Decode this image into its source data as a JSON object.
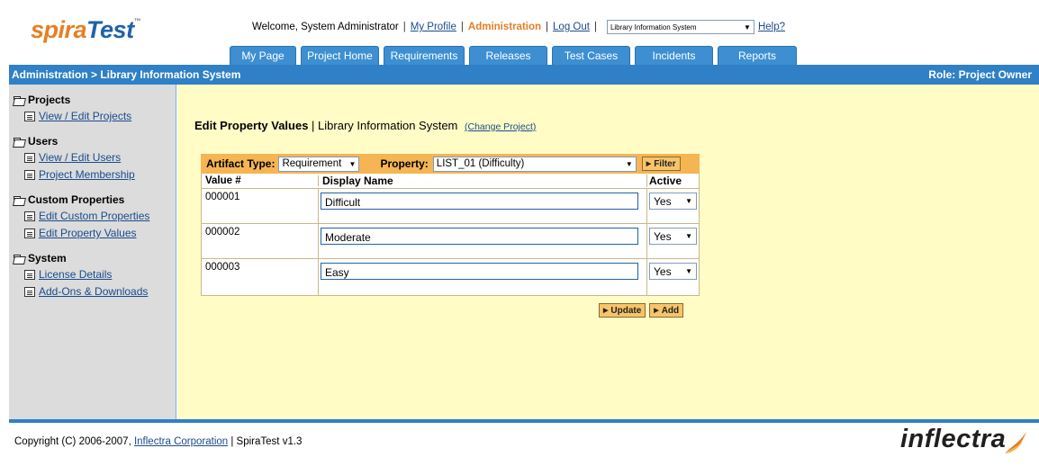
{
  "brand": {
    "part1": "spira",
    "part2": "Test",
    "tm": "™"
  },
  "topnav": {
    "welcome": "Welcome, System Administrator",
    "my_profile": "My Profile",
    "administration": "Administration",
    "log_out": "Log Out",
    "project_select": "Library Information System",
    "help": "Help?"
  },
  "tabs": [
    {
      "label": "My Page"
    },
    {
      "label": "Project Home"
    },
    {
      "label": "Requirements"
    },
    {
      "label": "Releases"
    },
    {
      "label": "Test Cases"
    },
    {
      "label": "Incidents"
    },
    {
      "label": "Reports"
    }
  ],
  "titlebar": {
    "breadcrumb": "Administration > Library Information System",
    "role": "Role: Project Owner"
  },
  "sidebar": {
    "sections": [
      {
        "title": "Projects",
        "items": [
          "View / Edit Projects"
        ]
      },
      {
        "title": "Users",
        "items": [
          "View / Edit Users",
          "Project Membership"
        ]
      },
      {
        "title": "Custom Properties",
        "items": [
          "Edit Custom Properties",
          "Edit Property Values"
        ]
      },
      {
        "title": "System",
        "items": [
          "License Details",
          "Add-Ons & Downloads"
        ]
      }
    ]
  },
  "main": {
    "heading_bold": "Edit Property Values",
    "heading_sep": " | ",
    "heading_project": "Library Information System",
    "change_project": "(Change Project)",
    "artifact_type_label": "Artifact Type:",
    "artifact_type_value": "Requirement",
    "property_label": "Property:",
    "property_value": "LIST_01 (Difficulty)",
    "filter_button": "Filter",
    "columns": {
      "value": "Value #",
      "display": "Display Name",
      "active": "Active"
    },
    "rows": [
      {
        "value": "000001",
        "display": "Difficult",
        "active": "Yes"
      },
      {
        "value": "000002",
        "display": "Moderate",
        "active": "Yes"
      },
      {
        "value": "000003",
        "display": "Easy",
        "active": "Yes"
      }
    ],
    "update_button": "Update",
    "add_button": "Add"
  },
  "footer": {
    "copyright_prefix": "Copyright (C) 2006-2007,",
    "company_link": "Inflectra Corporation",
    "version": "| SpiraTest v1.3",
    "logo": "inflectra"
  }
}
